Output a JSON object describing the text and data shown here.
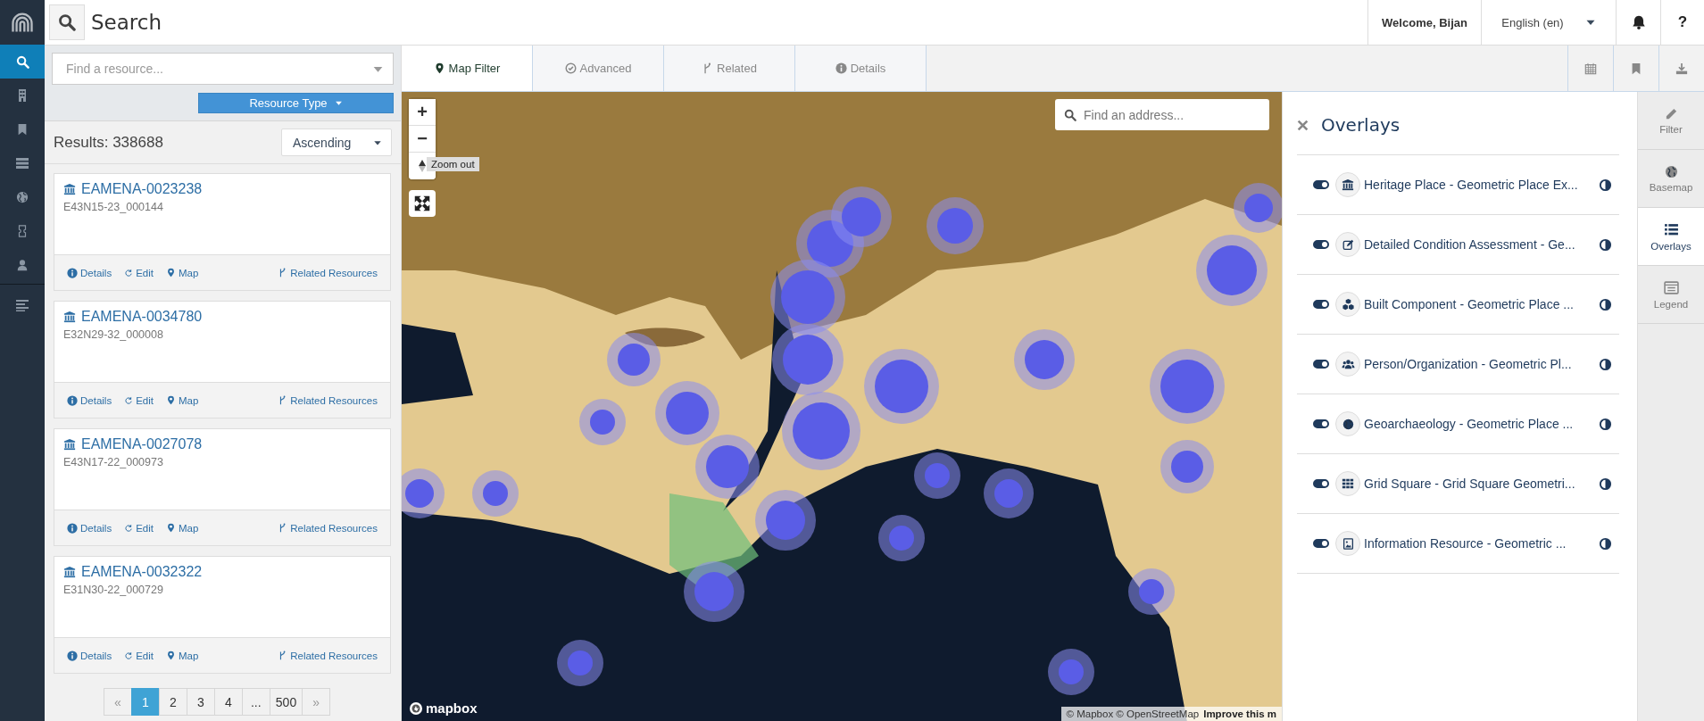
{
  "header": {
    "title": "Search",
    "welcome": "Welcome, Bijan",
    "language": "English (en)",
    "help": "?"
  },
  "nav_items": [
    {
      "selected": true
    },
    {
      "selected": false
    },
    {
      "selected": false
    },
    {
      "selected": false
    },
    {
      "selected": false
    },
    {
      "selected": false
    },
    {
      "selected": false
    },
    {
      "selected": false
    }
  ],
  "search_panel": {
    "placeholder": "Find a resource...",
    "filter_button": "Resource Type",
    "results": "Results: 338688",
    "sort": "Ascending"
  },
  "results": [
    {
      "title": "EAMENA-0023238",
      "subtitle": "E43N15-23_000144",
      "actions": [
        "Details",
        "Edit",
        "Map",
        "Related Resources"
      ]
    },
    {
      "title": "EAMENA-0034780",
      "subtitle": "E32N29-32_000008",
      "actions": [
        "Details",
        "Edit",
        "Map",
        "Related Resources"
      ]
    },
    {
      "title": "EAMENA-0027078",
      "subtitle": "E43N17-22_000973",
      "actions": [
        "Details",
        "Edit",
        "Map",
        "Related Resources"
      ]
    },
    {
      "title": "EAMENA-0032322",
      "subtitle": "E31N30-22_000729",
      "actions": [
        "Details",
        "Edit",
        "Map",
        "Related Resources"
      ]
    }
  ],
  "pagination": [
    {
      "label": "«",
      "selected": false
    },
    {
      "label": "1",
      "selected": true
    },
    {
      "label": "2",
      "selected": false
    },
    {
      "label": "3",
      "selected": false
    },
    {
      "label": "4",
      "selected": false
    },
    {
      "label": "...",
      "selected": false
    },
    {
      "label": "500",
      "selected": false
    },
    {
      "label": "»",
      "selected": false
    }
  ],
  "tabs": [
    {
      "label": "Map Filter",
      "selected": true
    },
    {
      "label": "Advanced",
      "selected": false
    },
    {
      "label": "Related",
      "selected": false
    },
    {
      "label": "Details",
      "selected": false
    }
  ],
  "map": {
    "zoom_in": "+",
    "zoom_out": "−",
    "tooltip": "Zoom out",
    "address_placeholder": "Find an address...",
    "logo": "mapbox",
    "attribution": "© Mapbox © OpenStreetMap",
    "improve": "Improve this m"
  },
  "overlays": {
    "title": "Overlays",
    "items": [
      {
        "label": "Heritage Place - Geometric Place Ex...",
        "on": true
      },
      {
        "label": "Detailed Condition Assessment - Ge...",
        "on": true
      },
      {
        "label": "Built Component - Geometric Place ...",
        "on": true
      },
      {
        "label": "Person/Organization - Geometric Pl...",
        "on": true
      },
      {
        "label": "Geoarchaeology - Geometric Place ...",
        "on": true
      },
      {
        "label": "Grid Square - Grid Square Geometri...",
        "on": true
      },
      {
        "label": "Information Resource - Geometric ...",
        "on": true
      }
    ]
  },
  "side_tabs": [
    {
      "label": "Filter",
      "selected": false
    },
    {
      "label": "Basemap",
      "selected": false
    },
    {
      "label": "Overlays",
      "selected": true
    },
    {
      "label": "Legend",
      "selected": false
    }
  ]
}
